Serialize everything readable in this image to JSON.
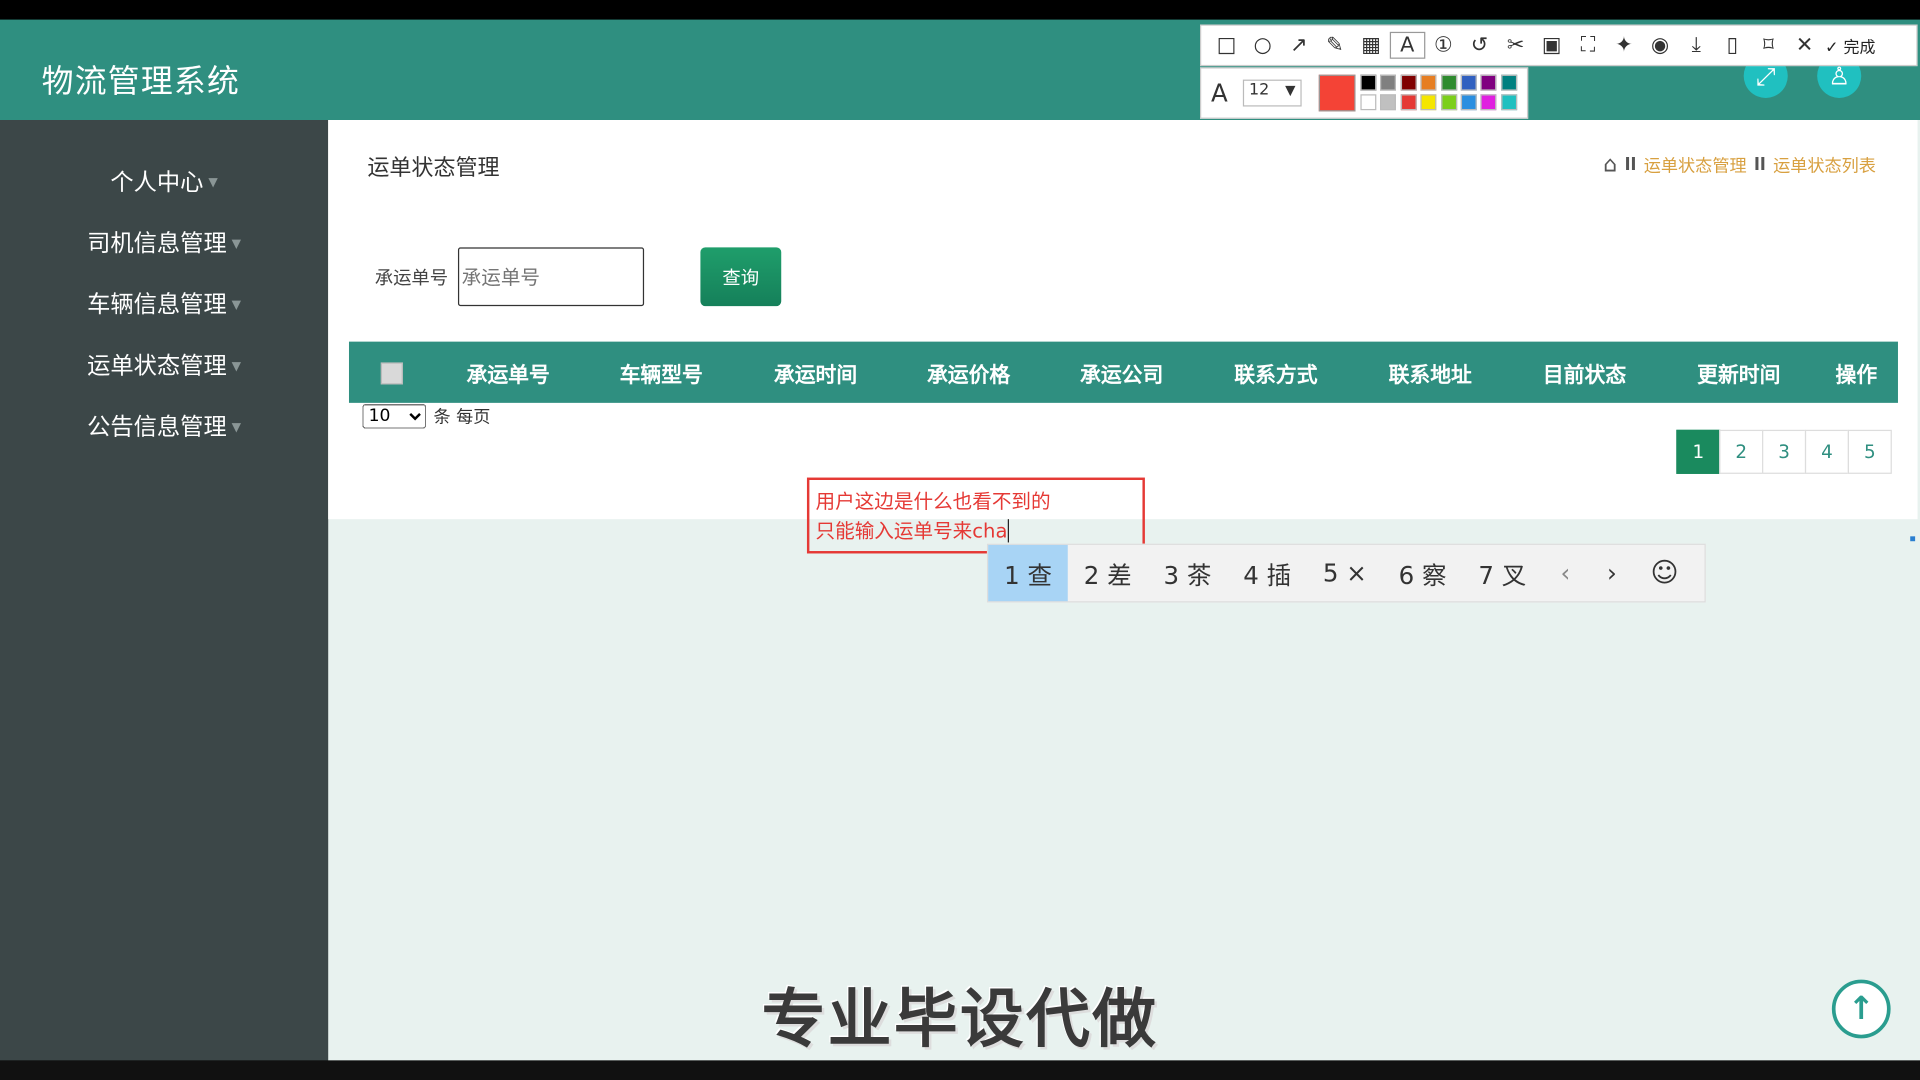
{
  "app": {
    "title": "物流管理系统"
  },
  "header": {
    "fullscreen_icon": "expand-icon",
    "user_icon": "user-icon"
  },
  "sidebar": {
    "items": [
      {
        "label": "个人中心"
      },
      {
        "label": "司机信息管理"
      },
      {
        "label": "车辆信息管理"
      },
      {
        "label": "运单状态管理"
      },
      {
        "label": "公告信息管理"
      }
    ]
  },
  "page": {
    "title": "运单状态管理",
    "breadcrumb": [
      "运单状态管理",
      "运单状态列表"
    ]
  },
  "search": {
    "label": "承运单号",
    "placeholder": "承运单号",
    "button": "查询"
  },
  "table": {
    "columns": [
      "承运单号",
      "车辆型号",
      "承运时间",
      "承运价格",
      "承运公司",
      "联系方式",
      "联系地址",
      "目前状态",
      "更新时间",
      "操作"
    ]
  },
  "pagination": {
    "per_page_value": "10",
    "per_page_suffix": "条 每页",
    "pages": [
      "1",
      "2",
      "3",
      "4",
      "5"
    ],
    "active_page": "1"
  },
  "snip_tool": {
    "done_label": "完成",
    "font_size": "12",
    "current_color": "#f44336",
    "palette_top": [
      "#000000",
      "#808080",
      "#800000",
      "#e67e22",
      "#2e8b2e",
      "#3060c0",
      "#800080",
      "#008080"
    ],
    "palette_bottom": [
      "#ffffff",
      "#c0c0c0",
      "#e53935",
      "#f5e600",
      "#7ccf1a",
      "#2a8ee0",
      "#e020e0",
      "#20c0c0"
    ]
  },
  "annotation": {
    "line1": "用户这边是什么也看不到的",
    "line2": "只能输入运单号来cha"
  },
  "ime": {
    "candidates": [
      "1 查",
      "2 差",
      "3 茶",
      "4 插",
      "5 ×",
      "6 察",
      "7 叉"
    ],
    "prev": "‹",
    "next": "›",
    "emoji": "☺"
  },
  "watermark": {
    "text": "专业毕设代做"
  }
}
